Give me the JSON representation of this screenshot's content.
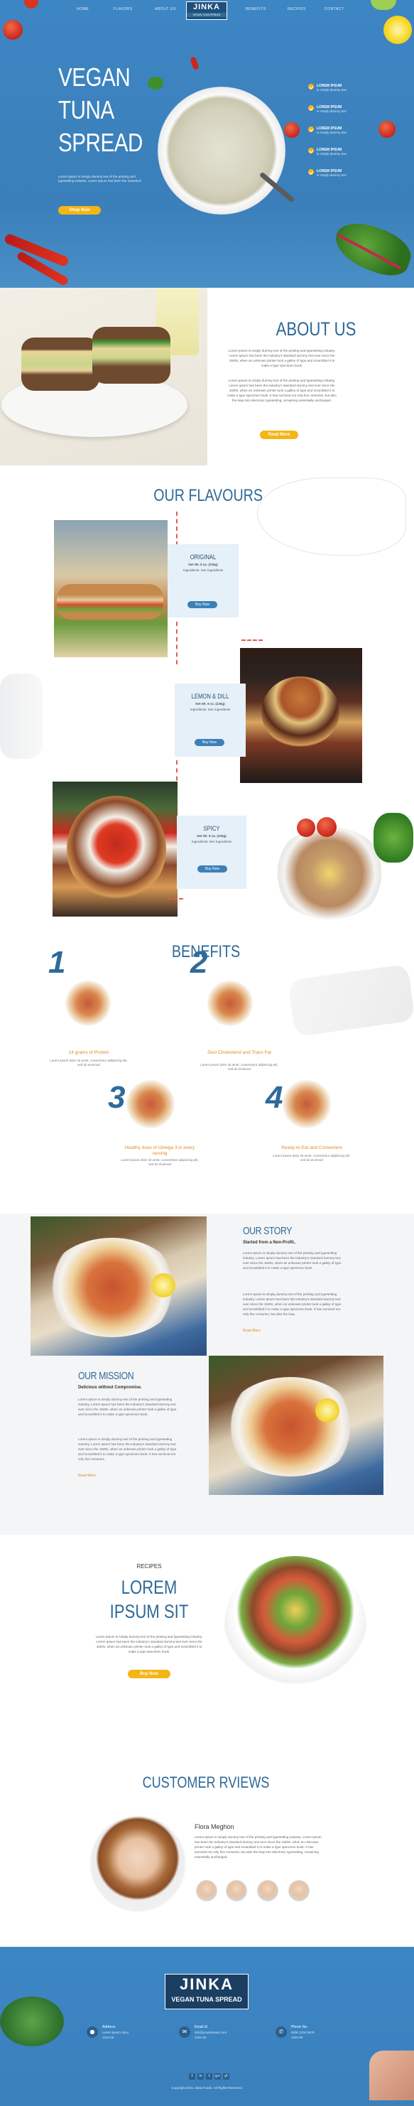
{
  "nav": {
    "items": [
      "HOME",
      "FLAVORS",
      "ABOUT US",
      "BENEFITS",
      "RECIPES",
      "CONTACT"
    ],
    "brand": "JINKA",
    "brand_sub": "VEGAN TUNA SPREAD"
  },
  "hero": {
    "title_1": "VEGAN",
    "title_2": "TUNA",
    "title_3": "SPREAD",
    "text": "Lorem Ipsum is simply dummy text of the printing and typesetting industry. Lorem Ipsum has been the industry's",
    "button": "Shop Now",
    "benefits": [
      {
        "title": "LOREM IPSUM",
        "text": "is simply dummy text"
      },
      {
        "title": "LOREM IPSUM",
        "text": "is simply dummy text"
      },
      {
        "title": "LOREM IPSUM",
        "text": "is simply dummy text"
      },
      {
        "title": "LOREM IPSUM",
        "text": "is simply dummy text"
      },
      {
        "title": "LOREM IPSUM",
        "text": "is simply dummy text"
      }
    ]
  },
  "about": {
    "title": "ABOUT US",
    "p1": "Lorem Ipsum is simply dummy text of the printing and typesetting industry. Lorem Ipsum has been the industry's standard dummy text ever since the 1500s, when an unknown printer took a galley of type and scrambled it to make a type specimen book.",
    "p2": "Lorem Ipsum is simply dummy text of the printing and typesetting industry. Lorem Ipsum has been the industry's standard dummy text ever since the 1500s, when an unknown printer took a galley of type and scrambled it to make a type specimen book. It has survived not only five centuries, but also the leap into electronic typesetting, remaining essentially unchanged.",
    "button": "Read More"
  },
  "flavours": {
    "title": "OUR FLAVOURS",
    "items": [
      {
        "name": "ORIGINAL",
        "weight": "Net Wt. 8 oz. (226g)",
        "note": "Ingredients: See Ingredients",
        "button": "Buy Now"
      },
      {
        "name": "LEMON & DILL",
        "weight": "Net Wt. 8 oz. (226g)",
        "note": "Ingredients: See Ingredients",
        "button": "Buy Now"
      },
      {
        "name": "SPICY",
        "weight": "Net Wt. 8 oz. (226g)",
        "note": "Ingredients: See Ingredients",
        "button": "Buy Now"
      }
    ]
  },
  "benefits": {
    "title": "BENEFITS",
    "items": [
      {
        "num": "1",
        "title": "14 grams of Protein",
        "text": "Lorem ipsum dolor sit amet, consectetur adipiscing elit, sed do eiusmod"
      },
      {
        "num": "2",
        "title": "Zero Cholesterol and Trans Fat",
        "text": "Lorem ipsum dolor sit amet, consectetur adipiscing elit, sed do eiusmod"
      },
      {
        "num": "3",
        "title": "Healthy dose of Omega 3 in every serving",
        "text": "Lorem ipsum dolor sit amet, consectetur adipiscing elit, sed do eiusmod"
      },
      {
        "num": "4",
        "title": "Ready-to-Eat and Convenient",
        "text": "Lorem ipsum dolor sit amet, consectetur adipiscing elit, sed do eiusmod"
      }
    ]
  },
  "story": {
    "title": "OUR STORY",
    "subtitle": "Started from a Non-Profit..",
    "p1": "Lorem Ipsum is simply dummy text of the printing and typesetting industry. Lorem Ipsum has been the industry's standard dummy text ever since the 1500s, when an unknown printer took a galley of type and scrambled it to make a type specimen book.",
    "p2": "Lorem Ipsum is simply dummy text of the printing and typesetting industry. Lorem Ipsum has been the industry's standard dummy text ever since the 1500s, when an unknown printer took a galley of type and scrambled it to make a type specimen book. It has survived not only five centuries, but also the leap.",
    "link": "Read More"
  },
  "mission": {
    "title": "OUR MISSION",
    "subtitle": "Delicious without Compromise.",
    "p1": "Lorem Ipsum is simply dummy text of the printing and typesetting industry. Lorem Ipsum has been the industry's standard dummy text ever since the 1500s, when an unknown printer took a galley of type and scrambled it to make a type specimen book.",
    "p2": "Lorem Ipsum is simply dummy text of the printing and typesetting industry. Lorem Ipsum has been the industry's standard dummy text ever since the 1500s, when an unknown printer took a galley of type and scrambled it to make a type specimen book. It has survived not only five centuries.",
    "link": "Read More"
  },
  "recipes": {
    "label": "RECIPES",
    "title_1": "LOREM",
    "title_2": "IPSUM SIT",
    "text": "Lorem Ipsum is simply dummy text of the printing and typesetting industry. Lorem Ipsum has been the industry's standard dummy text ever since the 1500s, when an unknown printer took a galley of type and scrambled it to make a type specimen book.",
    "button": "Buy Now"
  },
  "reviews": {
    "title": "CUSTOMER RVIEWS",
    "name": "Flora Meghon",
    "text": "Lorem Ipsum is simply dummy text of the printing and typesetting industry. Lorem Ipsum has been the industry's standard dummy text ever since the 1500s, when an unknown printer took a galley of type and scrambled it to make a type specimen book. It has survived not only five centuries, but also the leap into electronic typesetting, remaining essentially unchanged."
  },
  "footer": {
    "brand": "JINKA",
    "brand_sub": "VEGAN TUNA SPREAD",
    "address_label": "Address",
    "address_text": "Lorem ipsum dolor",
    "address_text2": "1234 56",
    "email_label": "Email Id",
    "email_text": "info@yourdomain.com",
    "email_text2": "1234 56",
    "phone_label": "Phone No.",
    "phone_text": "0000 1234 5678",
    "phone_text2": "1234 56",
    "social": [
      "f",
      "in",
      "t",
      "g+",
      "yt"
    ],
    "copyright": "Copyright 2021 Jinka Foods. All Rights Reserved"
  },
  "colors": {
    "primary_blue": "#3d86c4",
    "accent_yellow": "#f4b515",
    "heading_blue": "#2e6a99",
    "accent_red": "#e35c4e"
  }
}
